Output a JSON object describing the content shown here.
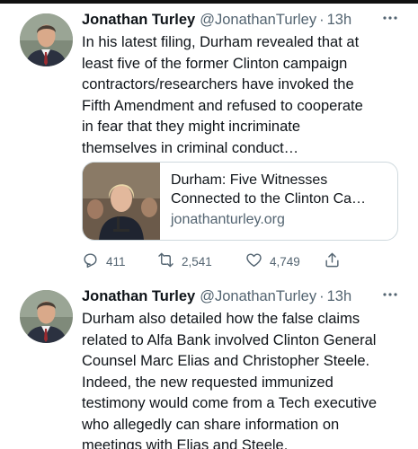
{
  "tweets": [
    {
      "author": {
        "name": "Jonathan Turley",
        "handle": "@JonathanTurley",
        "separator": "·",
        "time": "13h"
      },
      "more_icon": "more-horizontal-icon",
      "text_lines": [
        "In his latest filing, Durham revealed that at",
        "least five of the former Clinton campaign",
        "contractors/researchers have invoked the",
        "Fifth Amendment and refused to cooperate",
        "in fear that they might incriminate",
        "themselves in criminal conduct…"
      ],
      "card": {
        "title_lines": [
          "Durham: Five Witnesses",
          "Connected to the Clinton Ca…"
        ],
        "domain": "jonathanturley.org"
      },
      "actions": {
        "replies": "411",
        "retweets": "2,541",
        "likes": "4,749",
        "icons": [
          "reply-icon",
          "retweet-icon",
          "like-icon",
          "share-icon"
        ]
      }
    },
    {
      "author": {
        "name": "Jonathan Turley",
        "handle": "@JonathanTurley",
        "separator": "·",
        "time": "13h"
      },
      "more_icon": "more-horizontal-icon",
      "text_lines": [
        "Durham also detailed how the false claims",
        "related to Alfa Bank involved Clinton General",
        "Counsel Marc Elias and Christopher Steele.",
        "Indeed, the new requested immunized",
        "testimony would come from a Tech executive",
        "who allegedly can share information on",
        "meetings with Elias and Steele."
      ]
    }
  ],
  "colors": {
    "text": "#0f1419",
    "secondary": "#536471",
    "border": "#cfd9de"
  }
}
